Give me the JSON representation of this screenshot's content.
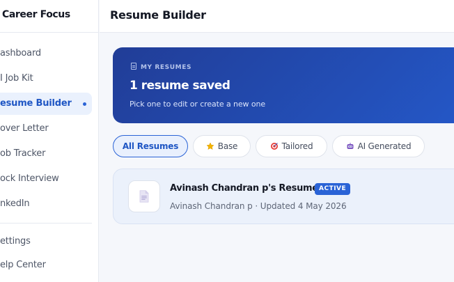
{
  "app": {
    "brand": "Career Focus"
  },
  "sidebar": {
    "items": [
      {
        "label": "ashboard"
      },
      {
        "label": "I Job Kit"
      },
      {
        "label": "esume Builder",
        "active": true
      },
      {
        "label": "over Letter"
      },
      {
        "label": "ob Tracker"
      },
      {
        "label": "ock Interview"
      },
      {
        "label": "nkedIn"
      }
    ],
    "secondary": [
      {
        "label": "ettings"
      },
      {
        "label": "elp Center"
      }
    ]
  },
  "header": {
    "title": "Resume Builder"
  },
  "banner": {
    "kicker": "MY RESUMES",
    "title": "1 resume saved",
    "subtitle": "Pick one to edit or create a new one"
  },
  "filters": [
    {
      "label": "All Resumes",
      "icon": "",
      "active": true
    },
    {
      "label": "Base",
      "icon": "star-icon",
      "active": false
    },
    {
      "label": "Tailored",
      "icon": "target-icon",
      "active": false
    },
    {
      "label": "AI Generated",
      "icon": "robot-icon",
      "active": false
    }
  ],
  "resumes": [
    {
      "title": "Avinash Chandran p's Resume",
      "badge": "ACTIVE",
      "meta": "Avinash Chandran p · Updated 4 May 2026"
    }
  ],
  "colors": {
    "accent": "#2a63d6",
    "banner_start": "#213d97",
    "banner_end": "#2458c8",
    "active_nav_bg": "#eaf1fd"
  }
}
